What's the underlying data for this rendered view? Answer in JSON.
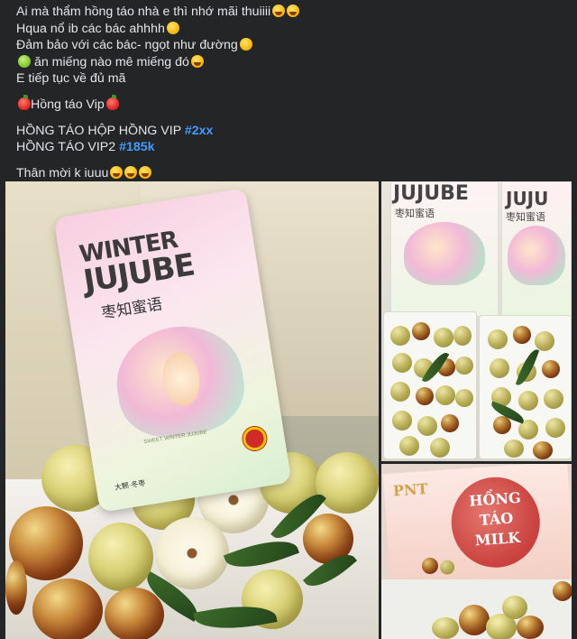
{
  "post": {
    "lines": [
      "Ai mà thẩm hồng táo nhà e thì nhớ mãi thuiiii",
      "Hqua nổ ib các bác ahhhh",
      "Đảm bảo với các bác- ngọt như đường",
      " ăn miếng nào mê miếng đó",
      "E tiếp tục về đủ mã",
      "Hồng táo Vip",
      "HỒNG TÁO HỘP HỒNG VIP ",
      "HỒNG TÁO VIP2 ",
      "Thân mời k iuuu"
    ],
    "hashtags": [
      "#2xx",
      "#185k"
    ]
  },
  "photos": {
    "main": {
      "card_title_1": "WINTER",
      "card_title_2": "JUJUBE",
      "card_cn": "枣知蜜语",
      "card_sub": "SWEET WINTER JUJUBE",
      "card_foot": "大颗·冬枣"
    },
    "top_right": {
      "box_title_1": "JUJUBE",
      "box_title_2": "JUJU",
      "box_cn": "枣知蜜语"
    },
    "bottom_right": {
      "brand": "PNT",
      "label_1": "HỒNG",
      "label_2": "TÁO",
      "label_3": "MILK"
    }
  },
  "colors": {
    "background": "#242526",
    "text": "#e4e6eb",
    "hashtag": "#4599ff"
  }
}
